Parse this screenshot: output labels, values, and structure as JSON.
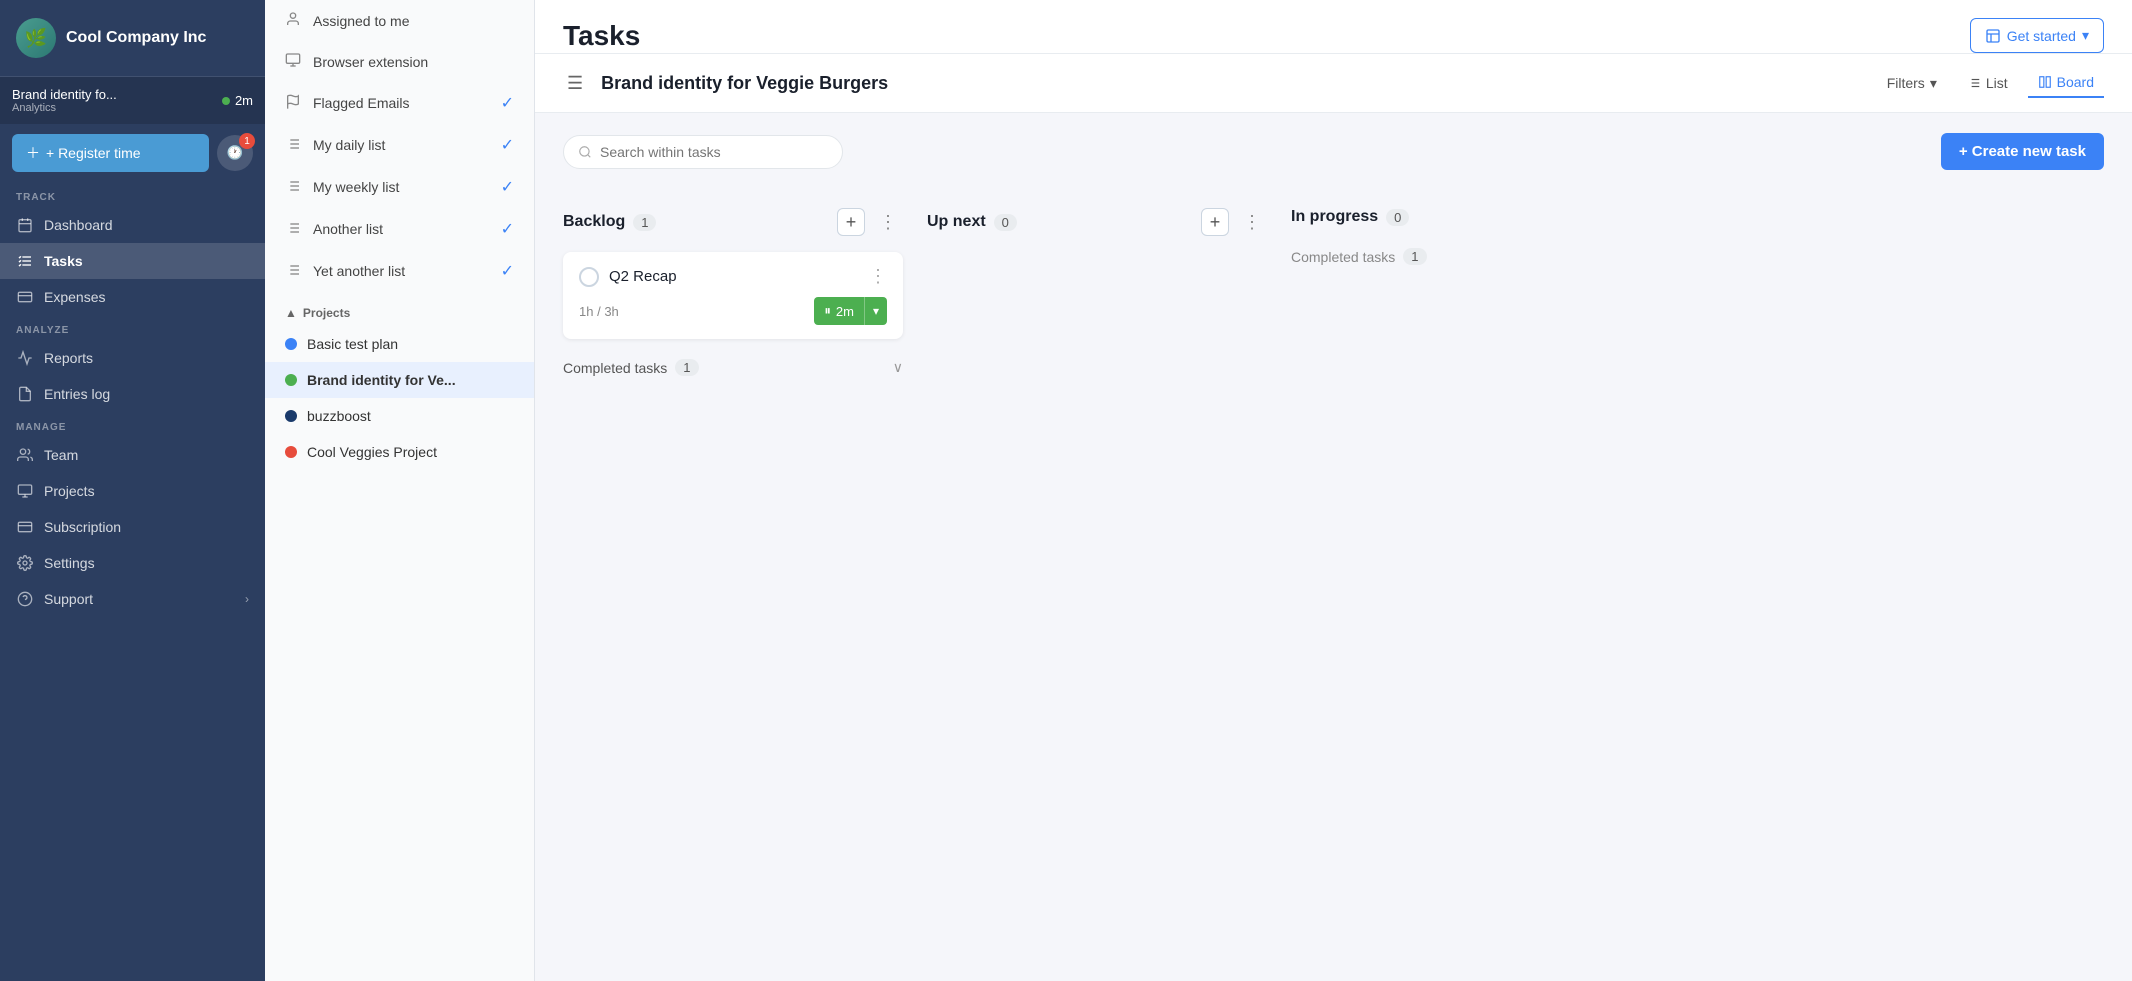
{
  "sidebar": {
    "company_name": "Cool Company Inc",
    "timer": {
      "project": "Brand identity fo...",
      "analytics": "Analytics",
      "time": "2m",
      "dot_color": "#4caf50"
    },
    "register_time_label": "+ Register time",
    "notification_count": "1",
    "sections": {
      "track_label": "TRACK",
      "analyze_label": "ANALYZE",
      "manage_label": "MANAGE"
    },
    "nav_items": [
      {
        "id": "dashboard",
        "label": "Dashboard",
        "icon": "calendar"
      },
      {
        "id": "tasks",
        "label": "Tasks",
        "icon": "tasks",
        "active": true
      },
      {
        "id": "expenses",
        "label": "Expenses",
        "icon": "expenses"
      }
    ],
    "analyze_items": [
      {
        "id": "reports",
        "label": "Reports",
        "icon": "reports"
      },
      {
        "id": "entries-log",
        "label": "Entries log",
        "icon": "entries"
      }
    ],
    "manage_items": [
      {
        "id": "team",
        "label": "Team",
        "icon": "team"
      },
      {
        "id": "projects",
        "label": "Projects",
        "icon": "projects"
      },
      {
        "id": "subscription",
        "label": "Subscription",
        "icon": "subscription"
      },
      {
        "id": "settings",
        "label": "Settings",
        "icon": "settings"
      },
      {
        "id": "support",
        "label": "Support",
        "icon": "support",
        "has_chevron": true
      }
    ]
  },
  "sub_panel": {
    "items": [
      {
        "id": "assigned-to-me",
        "label": "Assigned to me",
        "icon": "person",
        "checked": false
      },
      {
        "id": "browser-extension",
        "label": "Browser extension",
        "icon": "browser",
        "checked": false
      },
      {
        "id": "flagged-emails",
        "label": "Flagged Emails",
        "icon": "flag",
        "checked": true
      },
      {
        "id": "my-daily-list",
        "label": "My daily list",
        "icon": "list",
        "checked": true
      },
      {
        "id": "my-weekly-list",
        "label": "My weekly list",
        "icon": "list",
        "checked": true
      },
      {
        "id": "another-list",
        "label": "Another list",
        "icon": "list",
        "checked": true
      },
      {
        "id": "yet-another-list",
        "label": "Yet another list",
        "icon": "list",
        "checked": true
      }
    ],
    "projects_section": "Projects",
    "projects": [
      {
        "id": "basic-test-plan",
        "label": "Basic test plan",
        "color": "#3b82f6"
      },
      {
        "id": "brand-identity",
        "label": "Brand identity for Ve...",
        "color": "#4caf50",
        "active": true
      },
      {
        "id": "buzzboost",
        "label": "buzzboost",
        "color": "#1a3a6b"
      },
      {
        "id": "cool-veggies",
        "label": "Cool Veggies Project",
        "color": "#e74c3c"
      }
    ]
  },
  "header": {
    "page_title": "Tasks",
    "get_started_label": "Get started",
    "dropdown_arrow": "▾"
  },
  "toolbar": {
    "project_title": "Brand identity for Veggie Burgers",
    "filters_label": "Filters",
    "list_label": "List",
    "board_label": "Board"
  },
  "board": {
    "search_placeholder": "Search within tasks",
    "create_task_label": "+ Create new task",
    "columns": [
      {
        "id": "backlog",
        "title": "Backlog",
        "count": 1,
        "tasks": [
          {
            "id": "q2-recap",
            "title": "Q2 Recap",
            "time_logged": "1h",
            "time_estimate": "3h",
            "timer_label": "2m",
            "timer_running": true
          }
        ],
        "completed_count": 1
      },
      {
        "id": "up-next",
        "title": "Up next",
        "count": 0,
        "tasks": []
      },
      {
        "id": "in-progress",
        "title": "In progress",
        "count": 0,
        "tasks": [],
        "completed_count": 1
      }
    ]
  }
}
